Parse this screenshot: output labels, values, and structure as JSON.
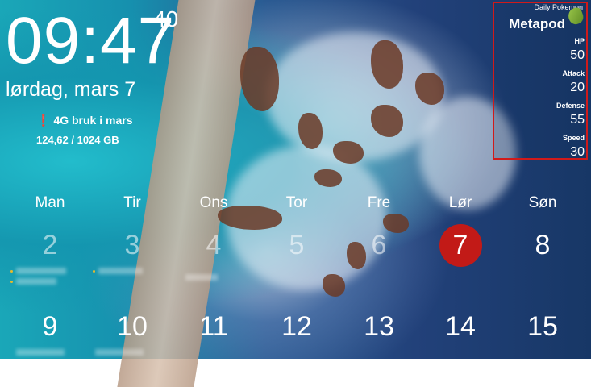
{
  "clock": {
    "time": "09:47",
    "seconds": "40",
    "date": "lørdag, mars 7"
  },
  "usage": {
    "label": "4G bruk i mars",
    "value": "124,62 / 1024 GB",
    "icon": "water-drop-icon"
  },
  "pokemon": {
    "header": "Daily Pokemon",
    "name": "Metapod",
    "stats": [
      {
        "label": "HP",
        "value": "50"
      },
      {
        "label": "Attack",
        "value": "20"
      },
      {
        "label": "Defense",
        "value": "55"
      },
      {
        "label": "Speed",
        "value": "30"
      }
    ]
  },
  "calendar": {
    "weekdays": [
      "Man",
      "Tir",
      "Ons",
      "Tor",
      "Fre",
      "Lør",
      "Søn"
    ],
    "week1": [
      "2",
      "3",
      "4",
      "5",
      "6",
      "7",
      "8"
    ],
    "week2": [
      "9",
      "10",
      "11",
      "12",
      "13",
      "14",
      "15"
    ]
  },
  "colors": {
    "today": "#c21a17",
    "highlight_border": "#d01a1a"
  }
}
